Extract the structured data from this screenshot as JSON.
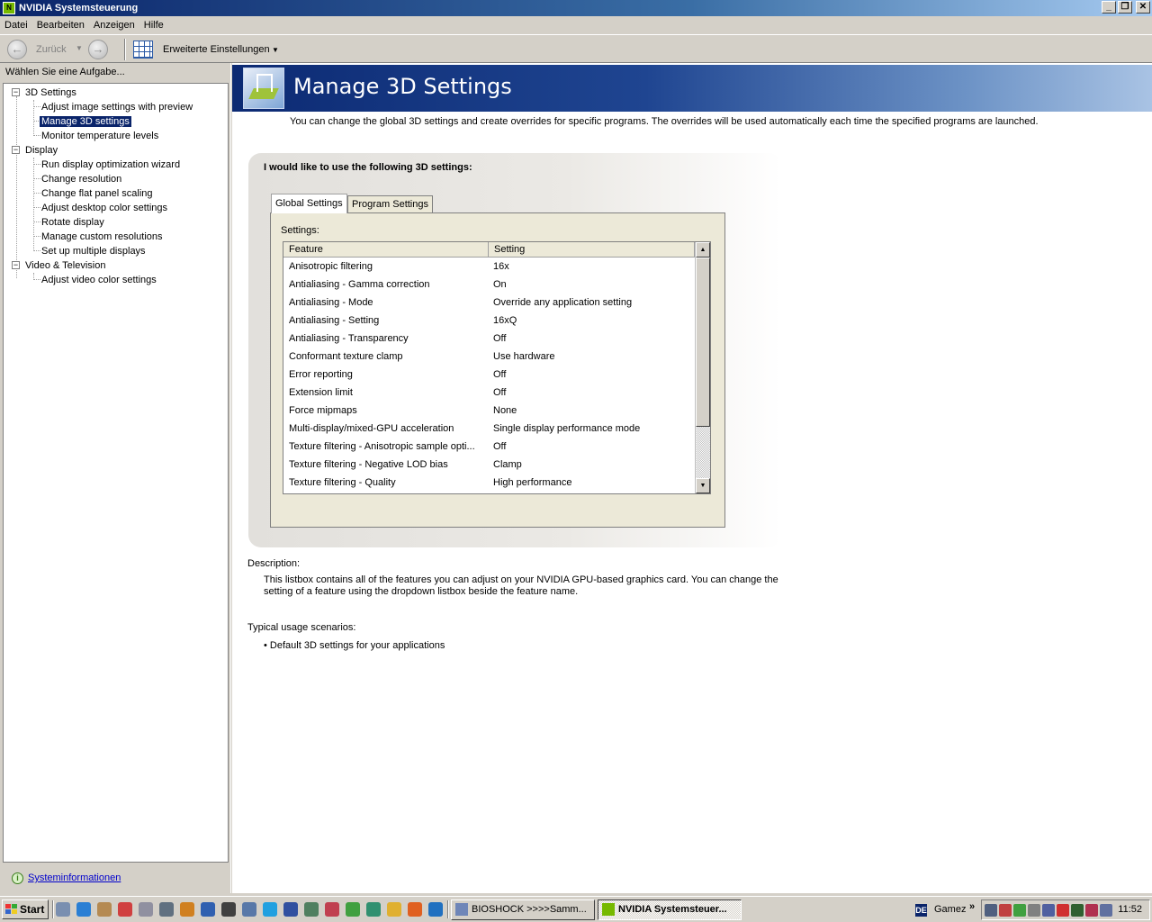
{
  "window": {
    "title": "NVIDIA Systemsteuerung"
  },
  "menu": [
    "Datei",
    "Bearbeiten",
    "Anzeigen",
    "Hilfe"
  ],
  "toolbar": {
    "back_label": "Zurück",
    "advanced_label": "Erweiterte Einstellungen"
  },
  "left": {
    "title": "Wählen Sie eine Aufgabe...",
    "tree": [
      {
        "label": "3D Settings",
        "children": [
          "Adjust image settings with preview",
          "Manage 3D settings",
          "Monitor temperature levels"
        ]
      },
      {
        "label": "Display",
        "children": [
          "Run display optimization wizard",
          "Change resolution",
          "Change flat panel scaling",
          "Adjust desktop color settings",
          "Rotate display",
          "Manage custom resolutions",
          "Set up multiple displays"
        ]
      },
      {
        "label": "Video & Television",
        "children": [
          "Adjust video color settings"
        ]
      }
    ],
    "selected": "Manage 3D settings",
    "sysinfo_link": "Systeminformationen"
  },
  "main": {
    "title": "Manage 3D Settings",
    "intro": "You can change the global 3D settings and create overrides for specific programs. The overrides will be used automatically each time the specified programs are launched.",
    "group_title": "I would like to use the following 3D settings:",
    "tabs": [
      "Global Settings",
      "Program Settings"
    ],
    "active_tab": "Global Settings",
    "settings_label": "Settings:",
    "columns": [
      "Feature",
      "Setting"
    ],
    "rows": [
      {
        "feature": "Anisotropic filtering",
        "setting": "16x"
      },
      {
        "feature": "Antialiasing - Gamma correction",
        "setting": "On"
      },
      {
        "feature": "Antialiasing - Mode",
        "setting": "Override any application setting"
      },
      {
        "feature": "Antialiasing - Setting",
        "setting": "16xQ"
      },
      {
        "feature": "Antialiasing - Transparency",
        "setting": "Off"
      },
      {
        "feature": "Conformant texture clamp",
        "setting": "Use hardware"
      },
      {
        "feature": "Error reporting",
        "setting": "Off"
      },
      {
        "feature": "Extension limit",
        "setting": "Off"
      },
      {
        "feature": "Force mipmaps",
        "setting": "None"
      },
      {
        "feature": "Multi-display/mixed-GPU acceleration",
        "setting": "Single display performance mode"
      },
      {
        "feature": "Texture filtering - Anisotropic sample opti...",
        "setting": "Off"
      },
      {
        "feature": "Texture filtering - Negative LOD bias",
        "setting": "Clamp"
      },
      {
        "feature": "Texture filtering - Quality",
        "setting": "High performance"
      }
    ],
    "description_heading": "Description:",
    "description": "This listbox contains all of the features you can adjust on your NVIDIA GPU-based graphics card. You can change the setting of a feature using the dropdown listbox beside the feature name.",
    "usage_heading": "Typical usage scenarios:",
    "usage_items": [
      "Default 3D settings for your applications"
    ]
  },
  "taskbar": {
    "start_label": "Start",
    "tasks": [
      {
        "label": "BIOSHOCK >>>>Samm...",
        "active": false
      },
      {
        "label": "NVIDIA Systemsteuer...",
        "active": true
      }
    ],
    "language": "DE",
    "toolbar_name": "Gamez",
    "clock": "11:52"
  },
  "colors": {
    "banner": "#0c2a73",
    "selection": "#0a246a",
    "link": "#0000cc",
    "nvidia_green": "#76b900"
  }
}
